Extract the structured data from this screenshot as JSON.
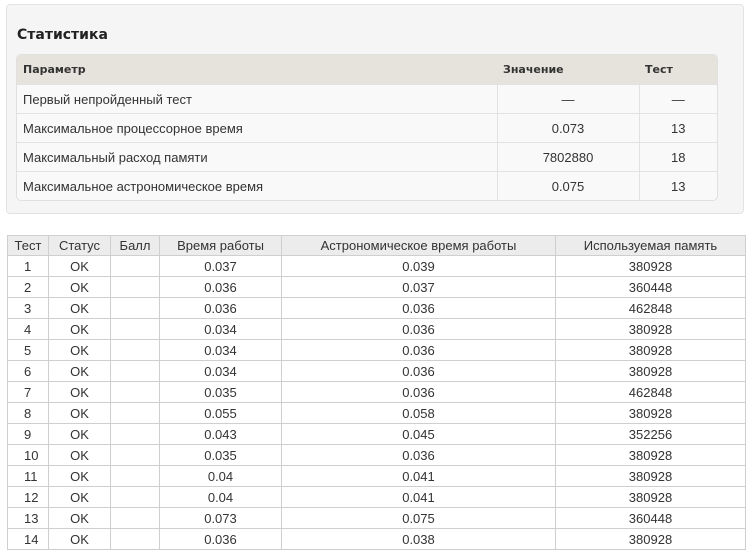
{
  "stats": {
    "title": "Статистика",
    "headers": {
      "param": "Параметр",
      "value": "Значение",
      "test": "Тест"
    },
    "rows": [
      {
        "param": "Первый непройденный тест",
        "value": "—",
        "test": "—"
      },
      {
        "param": "Максимальное процессорное время",
        "value": "0.073",
        "test": "13"
      },
      {
        "param": "Максимальный расход памяти",
        "value": "7802880",
        "test": "18"
      },
      {
        "param": "Максимальное астрономическое время",
        "value": "0.075",
        "test": "13"
      }
    ]
  },
  "tests": {
    "headers": [
      "Тест",
      "Статус",
      "Балл",
      "Время работы",
      "Астрономическое время работы",
      "Используемая память"
    ],
    "rows": [
      [
        "1",
        "OK",
        "",
        "0.037",
        "0.039",
        "380928"
      ],
      [
        "2",
        "OK",
        "",
        "0.036",
        "0.037",
        "360448"
      ],
      [
        "3",
        "OK",
        "",
        "0.036",
        "0.036",
        "462848"
      ],
      [
        "4",
        "OK",
        "",
        "0.034",
        "0.036",
        "380928"
      ],
      [
        "5",
        "OK",
        "",
        "0.034",
        "0.036",
        "380928"
      ],
      [
        "6",
        "OK",
        "",
        "0.034",
        "0.036",
        "380928"
      ],
      [
        "7",
        "OK",
        "",
        "0.035",
        "0.036",
        "462848"
      ],
      [
        "8",
        "OK",
        "",
        "0.055",
        "0.058",
        "380928"
      ],
      [
        "9",
        "OK",
        "",
        "0.043",
        "0.045",
        "352256"
      ],
      [
        "10",
        "OK",
        "",
        "0.035",
        "0.036",
        "380928"
      ],
      [
        "11",
        "OK",
        "",
        "0.04",
        "0.041",
        "380928"
      ],
      [
        "12",
        "OK",
        "",
        "0.04",
        "0.041",
        "380928"
      ],
      [
        "13",
        "OK",
        "",
        "0.073",
        "0.075",
        "360448"
      ],
      [
        "14",
        "OK",
        "",
        "0.036",
        "0.038",
        "380928"
      ]
    ]
  }
}
